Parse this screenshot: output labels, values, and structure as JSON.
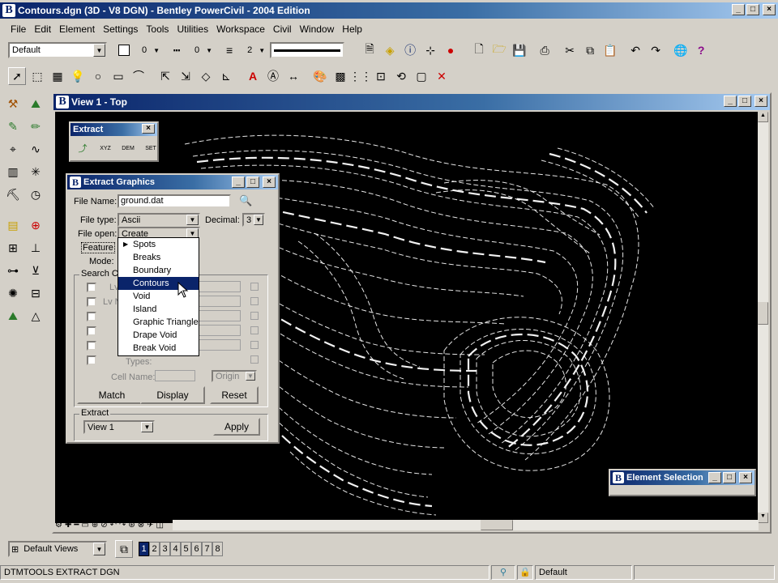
{
  "app": {
    "title": "Contours.dgn (3D - V8 DGN) - Bentley PowerCivil - 2004 Edition"
  },
  "menu": [
    "File",
    "Edit",
    "Element",
    "Settings",
    "Tools",
    "Utilities",
    "Workspace",
    "Civil",
    "Window",
    "Help"
  ],
  "attrbar": {
    "level": "Default",
    "color_val": "0",
    "style_val": "0",
    "weight_val": "2"
  },
  "view": {
    "title": "View 1 - Top"
  },
  "extract_palette": {
    "title": "Extract",
    "tools": [
      "XYZ",
      "DEM",
      "SET"
    ]
  },
  "extract_graphics": {
    "title": "Extract Graphics",
    "file_name_label": "File Name:",
    "file_name": "ground.dat",
    "file_type_label": "File type:",
    "file_type": "Ascii",
    "decimal_label": "Decimal:",
    "decimal": "3",
    "file_open_label": "File open:",
    "file_open": "Create",
    "feature_label": "Feature",
    "mode_label": "Mode:",
    "search_label": "Search Cr",
    "types_label": "Types:",
    "cell_name_label": "Cell Name:",
    "origin": "Origin",
    "match": "Match",
    "display": "Display",
    "reset": "Reset",
    "extract_group": "Extract",
    "extract_view": "View 1",
    "apply": "Apply"
  },
  "feature_dropdown": [
    "Spots",
    "Breaks",
    "Boundary",
    "Contours",
    "Void",
    "Island",
    "Graphic Triangle",
    "Drape Void",
    "Break Void"
  ],
  "element_selection": {
    "title": "Element Selection"
  },
  "bottom": {
    "views_combo": "Default Views",
    "view_numbers": [
      "1",
      "2",
      "3",
      "4",
      "5",
      "6",
      "7",
      "8"
    ]
  },
  "status": {
    "left": "DTMTOOLS EXTRACT DGN",
    "right": "Default"
  }
}
